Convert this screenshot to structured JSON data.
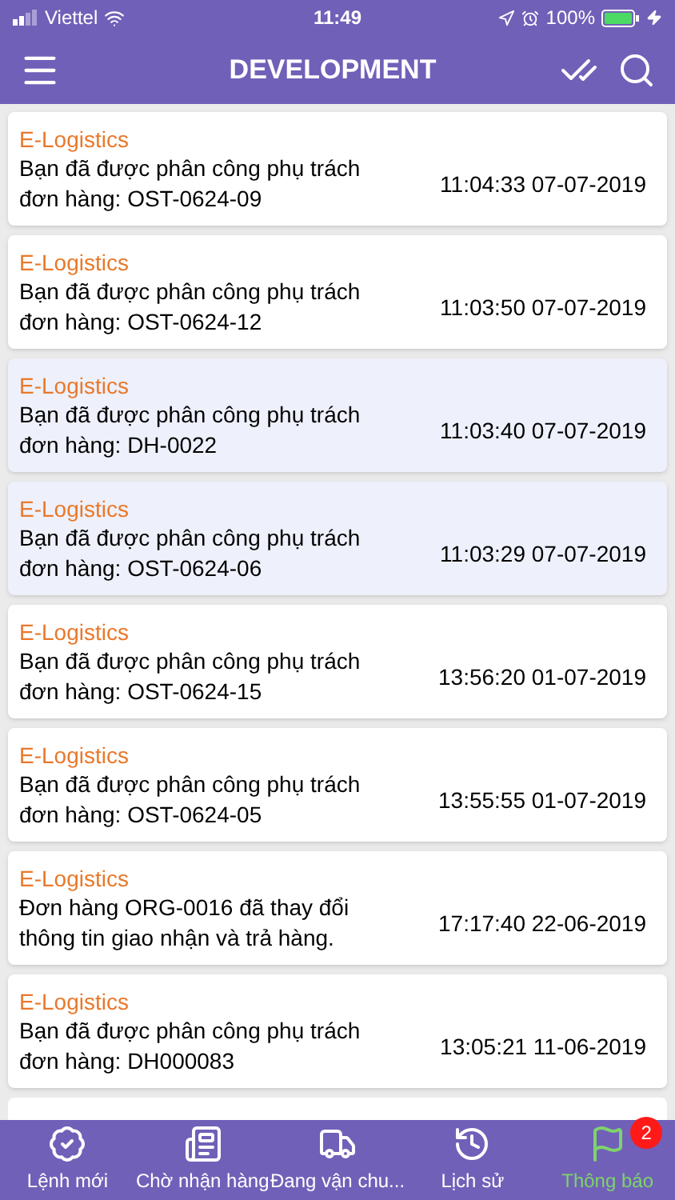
{
  "status_bar": {
    "carrier": "Viettel",
    "time": "11:49",
    "battery": "100%"
  },
  "header": {
    "title": "DEVELOPMENT"
  },
  "notifications": [
    {
      "source": "E-Logistics",
      "message": "Bạn đã được phân công phụ trách đơn hàng: OST-0624-09",
      "time": "11:04:33 07-07-2019",
      "highlighted": false
    },
    {
      "source": "E-Logistics",
      "message": "Bạn đã được phân công phụ trách đơn hàng: OST-0624-12",
      "time": "11:03:50 07-07-2019",
      "highlighted": false
    },
    {
      "source": "E-Logistics",
      "message": "Bạn đã được phân công phụ trách đơn hàng: DH-0022",
      "time": "11:03:40 07-07-2019",
      "highlighted": true
    },
    {
      "source": "E-Logistics",
      "message": "Bạn đã được phân công phụ trách đơn hàng: OST-0624-06",
      "time": "11:03:29 07-07-2019",
      "highlighted": true
    },
    {
      "source": "E-Logistics",
      "message": "Bạn đã được phân công phụ trách đơn hàng: OST-0624-15",
      "time": "13:56:20 01-07-2019",
      "highlighted": false
    },
    {
      "source": "E-Logistics",
      "message": "Bạn đã được phân công phụ trách đơn hàng: OST-0624-05",
      "time": "13:55:55 01-07-2019",
      "highlighted": false
    },
    {
      "source": "E-Logistics",
      "message": "Đơn hàng ORG-0016 đã thay đổi thông tin giao nhận và trả hàng.",
      "time": "17:17:40 22-06-2019",
      "highlighted": false
    },
    {
      "source": "E-Logistics",
      "message": "Bạn đã được phân công phụ trách đơn hàng: DH000083",
      "time": "13:05:21 11-06-2019",
      "highlighted": false
    }
  ],
  "tabs": [
    {
      "kind": "badge-new",
      "label": "Lệnh mới",
      "selected": false
    },
    {
      "kind": "news",
      "label": "Chờ nhận hàng",
      "selected": false
    },
    {
      "kind": "truck",
      "label": "Đang vận chu...",
      "selected": false
    },
    {
      "kind": "history",
      "label": "Lịch sử",
      "selected": false
    },
    {
      "kind": "flag",
      "label": "Thông báo",
      "selected": true,
      "badge": "2"
    }
  ]
}
